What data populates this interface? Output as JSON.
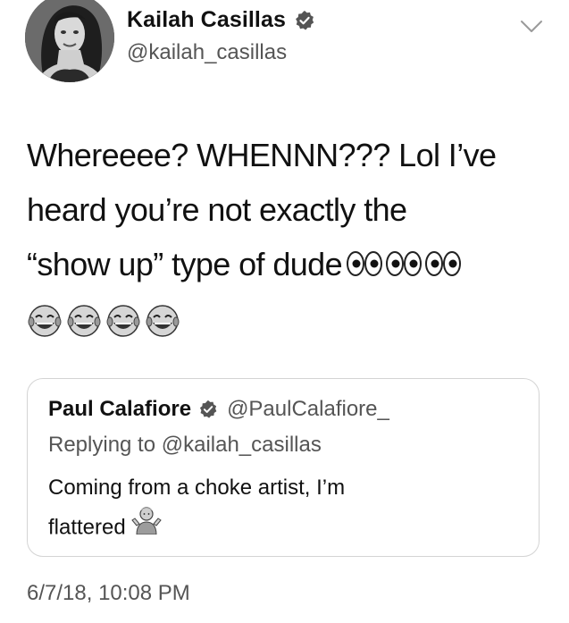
{
  "author": {
    "display_name": "Kailah Casillas",
    "handle": "@kailah_casillas",
    "verified": true,
    "avatar_icon": "profile-photo"
  },
  "tweet": {
    "lines": [
      "Whereeee? WHENNN??? Lol I’ve",
      "heard you’re not exactly the",
      "“show up” type of dude"
    ],
    "emoji_eyes_count": 3,
    "emoji_laugh_count": 4,
    "timestamp": "6/7/18, 10:08 PM"
  },
  "quoted_tweet": {
    "display_name": "Paul Calafiore",
    "handle": "@PaulCalafiore_",
    "verified": true,
    "reply_context": "Replying to @kailah_casillas",
    "lines": [
      "Coming from a choke artist, I’m",
      "flattered"
    ],
    "emoji": "person-shrugging"
  },
  "icons": {
    "verified": "verified-badge-icon",
    "menu": "chevron-down-icon",
    "eyes": "eyes-emoji",
    "laugh": "tears-of-joy-emoji",
    "shrug": "person-shrugging-emoji"
  },
  "colors": {
    "text_primary": "#111111",
    "text_secondary": "#555555",
    "card_border": "#d4d4d4",
    "background": "#ffffff"
  }
}
